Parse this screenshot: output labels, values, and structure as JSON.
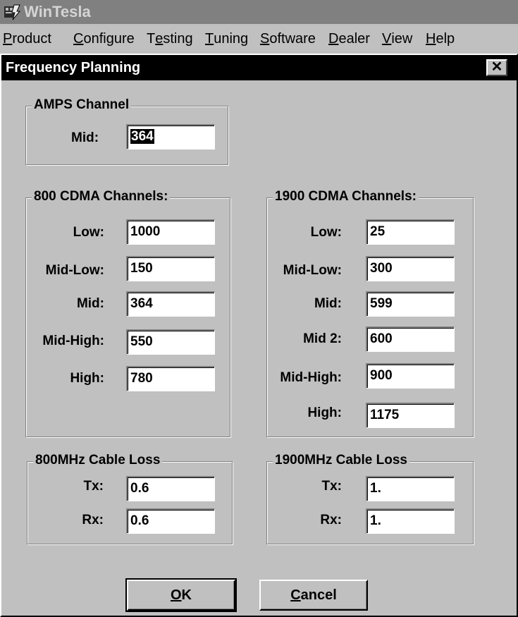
{
  "window": {
    "title": "WinTesla",
    "icon": "wintesla-app-icon"
  },
  "menu": [
    {
      "mnemonic": "P",
      "rest": "roduct"
    },
    {
      "mnemonic": "C",
      "rest": "onfigure"
    },
    {
      "pre": "T",
      "mnemonic": "e",
      "rest": "sting"
    },
    {
      "mnemonic": "T",
      "rest": "uning"
    },
    {
      "mnemonic": "S",
      "rest": "oftware"
    },
    {
      "mnemonic": "D",
      "rest": "ealer"
    },
    {
      "mnemonic": "V",
      "rest": "iew"
    },
    {
      "mnemonic": "H",
      "rest": "elp"
    }
  ],
  "dialog": {
    "title": "Frequency Planning",
    "close_glyph": "✕",
    "amps": {
      "title": "AMPS Channel",
      "mid_label": "Mid:",
      "mid_value": "364"
    },
    "cdma800": {
      "title": "800 CDMA Channels:",
      "rows": [
        {
          "label": "Low:",
          "value": "1000"
        },
        {
          "label": "Mid-Low:",
          "value": "150"
        },
        {
          "label": "Mid:",
          "value": "364"
        },
        {
          "label": "Mid-High:",
          "value": "550"
        },
        {
          "label": "High:",
          "value": "780"
        }
      ]
    },
    "cdma1900": {
      "title": "1900 CDMA Channels:",
      "rows": [
        {
          "label": "Low:",
          "value": "25"
        },
        {
          "label": "Mid-Low:",
          "value": "300"
        },
        {
          "label": "Mid:",
          "value": "599"
        },
        {
          "label": "Mid 2:",
          "value": "600"
        },
        {
          "label": "Mid-High:",
          "value": "900"
        },
        {
          "label": "High:",
          "value": "1175"
        }
      ]
    },
    "loss800": {
      "title": "800MHz Cable Loss",
      "tx_label": "Tx:",
      "tx_value": "0.6",
      "rx_label": "Rx:",
      "rx_value": "0.6"
    },
    "loss1900": {
      "title": "1900MHz Cable Loss",
      "tx_label": "Tx:",
      "tx_value": "1.",
      "rx_label": "Rx:",
      "rx_value": "1."
    },
    "ok": {
      "mnemonic": "O",
      "rest": "K"
    },
    "cancel": {
      "mnemonic": "C",
      "rest": "ancel"
    }
  }
}
